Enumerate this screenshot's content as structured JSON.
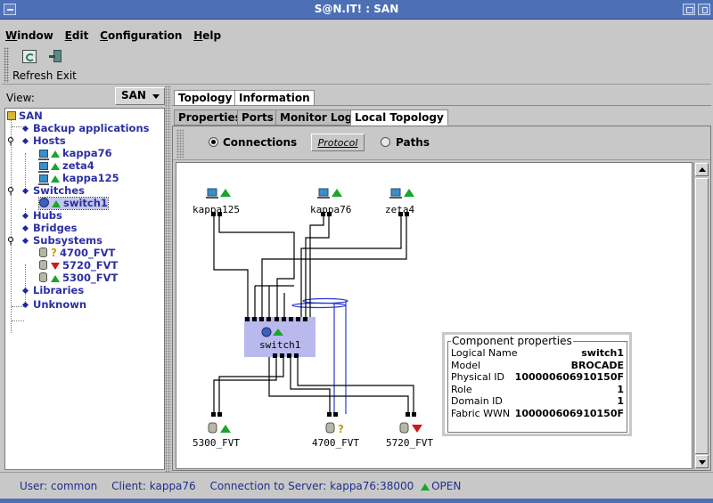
{
  "window": {
    "title": "S@N.IT! : SAN"
  },
  "menu": [
    "Window",
    "Edit",
    "Configuration",
    "Help"
  ],
  "toolbar": {
    "refresh_label": "Refresh",
    "exit_label": "Exit"
  },
  "view": {
    "label": "View:",
    "selected": "SAN"
  },
  "tree": {
    "root": "SAN",
    "backup": "Backup applications",
    "hosts": "Hosts",
    "host_items": [
      "kappa76",
      "zeta4",
      "kappa125"
    ],
    "switches": "Switches",
    "switch_items": [
      "switch1"
    ],
    "hubs": "Hubs",
    "bridges": "Bridges",
    "subsystems": "Subsystems",
    "subsystem_items": [
      "4700_FVT",
      "5720_FVT",
      "5300_FVT"
    ],
    "libraries": "Libraries",
    "unknown": "Unknown"
  },
  "tabs": {
    "outer": [
      "Topology",
      "Information"
    ],
    "inner": [
      "Properties",
      "Ports",
      "Monitor Log",
      "Local Topology"
    ]
  },
  "radio": {
    "connections": "Connections",
    "protocol": "Protocol",
    "paths": "Paths"
  },
  "topology": {
    "hosts": [
      "kappa125",
      "kappa76",
      "zeta4"
    ],
    "switch": "switch1",
    "subsystems": [
      "5300_FVT",
      "4700_FVT",
      "5720_FVT"
    ]
  },
  "properties": {
    "title": "Component properties",
    "rows": [
      {
        "key": "Logical Name",
        "value": "switch1"
      },
      {
        "key": "Model",
        "value": "BROCADE"
      },
      {
        "key": "Physical ID",
        "value": "100000606910150F"
      },
      {
        "key": "Role",
        "value": "1"
      },
      {
        "key": "Domain ID",
        "value": "1"
      },
      {
        "key": "Fabric WWN",
        "value": "100000606910150F"
      }
    ]
  },
  "status": {
    "user_label": "User:",
    "user": "common",
    "client_label": "Client:",
    "client": "kappa76",
    "server_label": "Connection to Server:",
    "server": "kappa76:38000",
    "state": "OPEN"
  }
}
